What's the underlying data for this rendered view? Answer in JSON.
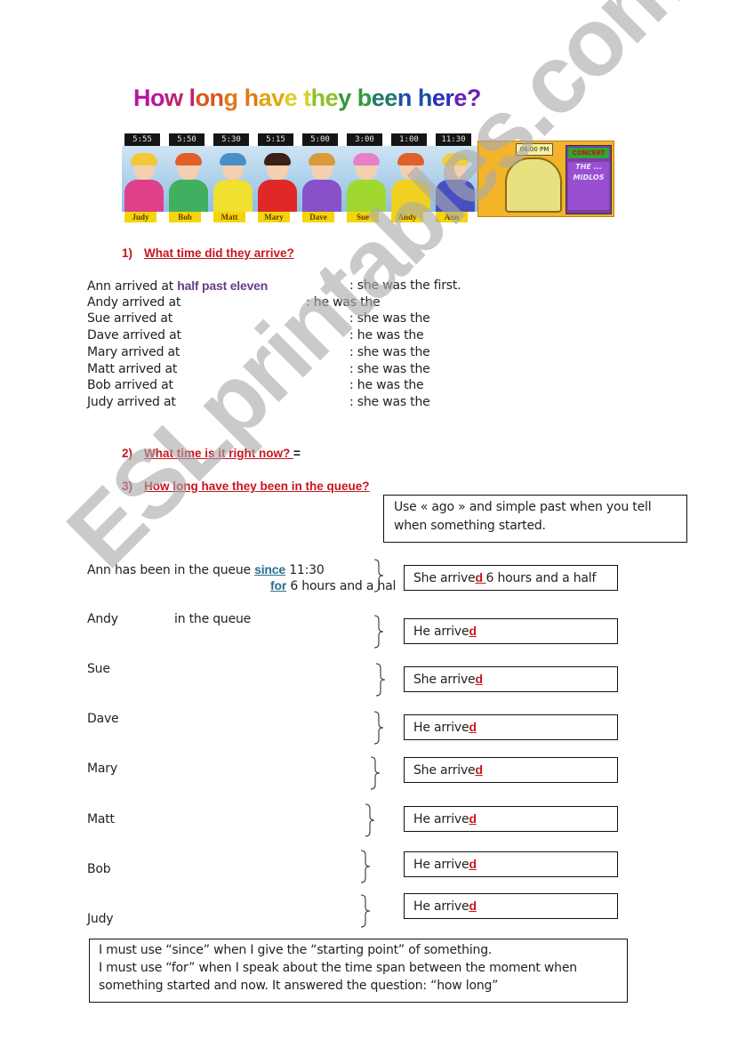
{
  "title": "How long have they been here?",
  "title_colors": [
    "#b5179e",
    "#c0226f",
    "#d8551e",
    "#e07a1a",
    "#e0a60f",
    "#d9cf2a",
    "#8fbf2a",
    "#2e9b3e",
    "#1f7a6a",
    "#1a4fa8",
    "#2a2fb8",
    "#6a22b0"
  ],
  "banner": {
    "clocks": [
      "5:55",
      "5:50",
      "5:30",
      "5:15",
      "5:00",
      "3:00",
      "1:00",
      "11:30"
    ],
    "names": [
      "Judy",
      "Bob",
      "Matt",
      "Mary",
      "Dave",
      "Sue",
      "Andy",
      "Ann"
    ],
    "booth_clock": "06:00 PM",
    "poster_header": "CONCERT",
    "poster_text": "THE ... MIDLOS"
  },
  "section1": {
    "number": "1)",
    "heading": "What time did they arrive?",
    "rows": [
      {
        "subject": "Ann arrived at",
        "answer": "half past eleven",
        "suffix": ": she was the first."
      },
      {
        "subject": "Andy arrived at",
        "answer": "",
        "suffix": ": he was the"
      },
      {
        "subject": "Sue arrived at",
        "answer": "",
        "suffix": ": she was the"
      },
      {
        "subject": "Dave arrived at",
        "answer": "",
        "suffix": ": he was the"
      },
      {
        "subject": "Mary arrived at",
        "answer": "",
        "suffix": ": she was the"
      },
      {
        "subject": "Matt arrived at",
        "answer": "",
        "suffix": ": she was the"
      },
      {
        "subject": "Bob arrived at",
        "answer": "",
        "suffix": ": he was the"
      },
      {
        "subject": "Judy arrived at",
        "answer": "",
        "suffix": ": she was the"
      }
    ]
  },
  "section2": {
    "number": "2)",
    "heading": "What time is it right now? ",
    "equals": "="
  },
  "section3": {
    "number": "3)",
    "heading": "How long have they been in the queue?"
  },
  "note_ago": {
    "line1": "Use « ago » and simple past when you tell",
    "line2": "when something started."
  },
  "queue": {
    "example": {
      "prefix": "Ann has been in the queue ",
      "since_word": "since",
      "since_value": " 11:30",
      "for_word": "for",
      "for_value": " 6 hours and a hal"
    },
    "andy_middle": "in the queue",
    "names": [
      "Andy",
      "Sue",
      "Dave",
      "Mary",
      "Matt",
      "Bob",
      "Judy"
    ],
    "answers": [
      {
        "stem": "She arrive",
        "d": "d",
        "rest": " 6 hours and a half"
      },
      {
        "stem": "He arrive",
        "d": "d",
        "rest": ""
      },
      {
        "stem": "She arrive",
        "d": "d",
        "rest": ""
      },
      {
        "stem": "He arrive",
        "d": "d",
        "rest": ""
      },
      {
        "stem": "She arrive",
        "d": "d",
        "rest": ""
      },
      {
        "stem": "He arrive",
        "d": "d",
        "rest": ""
      },
      {
        "stem": "He arrive",
        "d": "d",
        "rest": ""
      },
      {
        "stem": "He arrive",
        "d": "d",
        "rest": ""
      }
    ]
  },
  "note_since_for": {
    "line1": "I must use “since” when I give the “starting point” of something.",
    "line2": "I must use “for” when I speak about the time span between the moment when",
    "line3": "something started and now. It answered the question: “how long”"
  },
  "watermark": "ESLprintables.com"
}
